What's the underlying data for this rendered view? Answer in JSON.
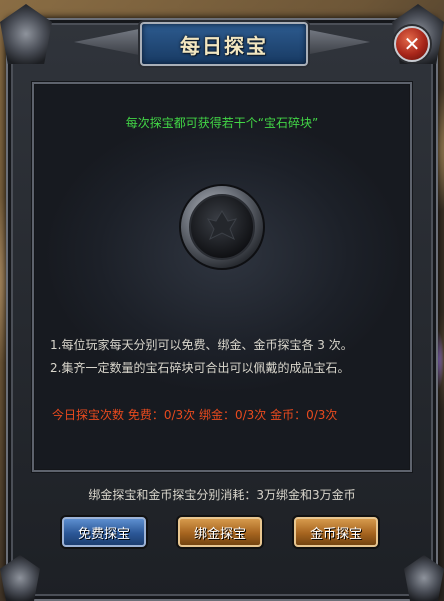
{
  "window": {
    "title": "每日探宝",
    "close_glyph": "✕"
  },
  "subtitle": "每次探宝都可获得若干个“宝石碎块”",
  "orb": {
    "icon": "gem-socket-icon"
  },
  "description": {
    "line1": "1.每位玩家每天分别可以免费、绑金、金币探宝各 3 次。",
    "line2": "2.集齐一定数量的宝石碎块可合出可以佩戴的成品宝石。"
  },
  "counts": {
    "text": "今日探宝次数  免费：0/3次  绑金：0/3次  金币：0/3次"
  },
  "cost_text": "绑金探宝和金币探宝分别消耗：3万绑金和3万金币",
  "buttons": {
    "free": "免费探宝",
    "bound_gold": "绑金探宝",
    "gold": "金币探宝"
  },
  "colors": {
    "subtitle": "#42d646",
    "counts": "#e84a1e",
    "title_plate": "#2d5b8f"
  }
}
